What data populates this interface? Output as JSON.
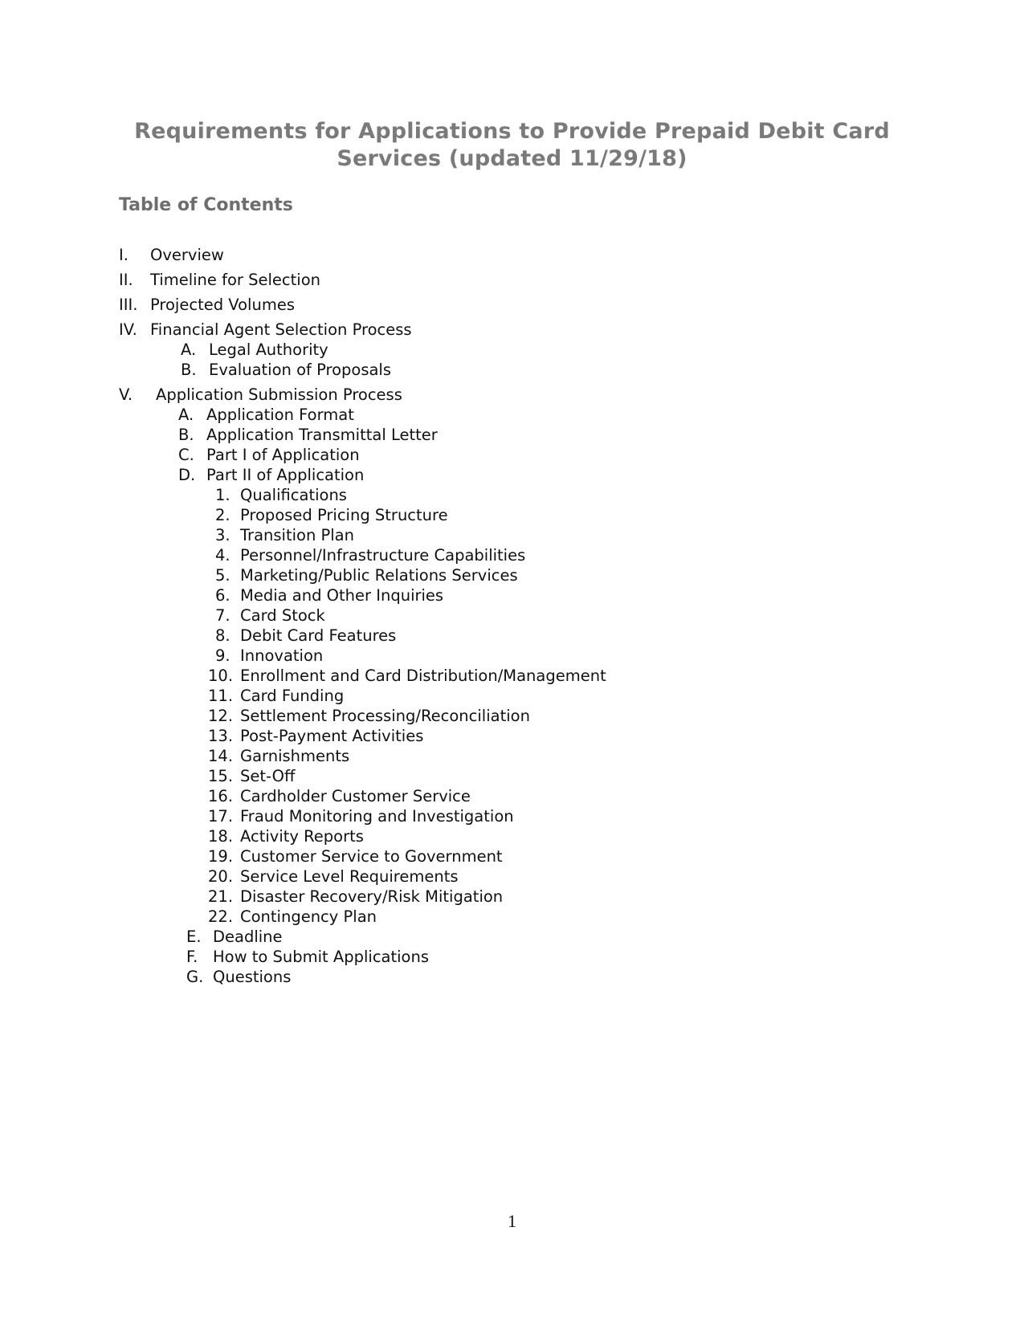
{
  "document": {
    "title_line1": "Requirements for Applications to Provide Prepaid Debit Card",
    "title_line2": "Services (updated 11/29/18)",
    "toc_heading": "Table of Contents",
    "page_number": "1"
  },
  "toc": {
    "sections": [
      {
        "marker": "I.",
        "label": "Overview"
      },
      {
        "marker": "II.",
        "label": "Timeline for Selection"
      },
      {
        "marker": "III.",
        "label": "Projected Volumes"
      },
      {
        "marker": "IV.",
        "label": "Financial Agent Selection Process",
        "subsections": [
          {
            "marker": "A.",
            "label": "Legal Authority"
          },
          {
            "marker": "B.",
            "label": "Evaluation of Proposals"
          }
        ]
      },
      {
        "marker": "V.",
        "label": "Application Submission Process",
        "subsections": [
          {
            "marker": "A.",
            "label": "Application Format"
          },
          {
            "marker": "B.",
            "label": "Application Transmittal Letter"
          },
          {
            "marker": "C.",
            "label": "Part I of Application"
          },
          {
            "marker": "D.",
            "label": "Part II of Application",
            "items": [
              {
                "marker": "1.",
                "label": "Qualifications"
              },
              {
                "marker": "2.",
                "label": "Proposed Pricing Structure"
              },
              {
                "marker": "3.",
                "label": "Transition Plan"
              },
              {
                "marker": "4.",
                "label": "Personnel/Infrastructure Capabilities"
              },
              {
                "marker": "5.",
                "label": "Marketing/Public Relations Services"
              },
              {
                "marker": "6.",
                "label": "Media and Other Inquiries"
              },
              {
                "marker": "7.",
                "label": "Card Stock"
              },
              {
                "marker": "8.",
                "label": "Debit Card Features"
              },
              {
                "marker": "9.",
                "label": "Innovation"
              },
              {
                "marker": "10.",
                "label": "Enrollment and Card Distribution/Management"
              },
              {
                "marker": "11.",
                "label": "Card Funding"
              },
              {
                "marker": "12.",
                "label": "Settlement Processing/Reconciliation"
              },
              {
                "marker": "13.",
                "label": "Post-Payment Activities"
              },
              {
                "marker": "14.",
                "label": "Garnishments"
              },
              {
                "marker": "15.",
                "label": "Set-Off"
              },
              {
                "marker": "16.",
                "label": "Cardholder Customer Service"
              },
              {
                "marker": "17.",
                "label": "Fraud Monitoring and Investigation"
              },
              {
                "marker": "18.",
                "label": "Activity Reports"
              },
              {
                "marker": "19.",
                "label": "Customer Service to Government"
              },
              {
                "marker": "20.",
                "label": "Service Level Requirements"
              },
              {
                "marker": "21.",
                "label": "Disaster Recovery/Risk Mitigation"
              },
              {
                "marker": "22.",
                "label": "Contingency Plan"
              }
            ]
          },
          {
            "marker": "E.",
            "label": "Deadline"
          },
          {
            "marker": "F.",
            "label": "How to Submit Applications"
          },
          {
            "marker": "G.",
            "label": "Questions"
          }
        ]
      }
    ]
  }
}
